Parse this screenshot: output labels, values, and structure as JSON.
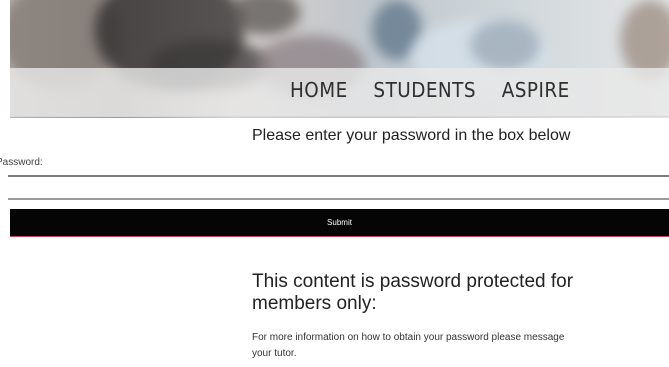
{
  "nav": {
    "items": [
      {
        "label": "HOME"
      },
      {
        "label": "STUDENTS"
      },
      {
        "label": "ASPIRE"
      }
    ]
  },
  "form": {
    "heading": "Please enter your password in the box below",
    "password_label": "Password:",
    "password_value": "",
    "submit_label": "Submit"
  },
  "notice": {
    "title": "This content is password protected for members only:",
    "body": "For more information on how to obtain your password please message your tutor."
  }
}
